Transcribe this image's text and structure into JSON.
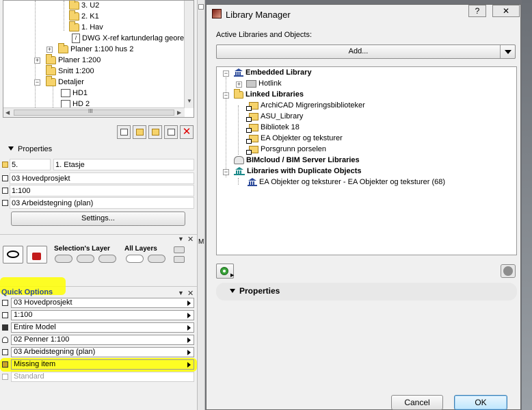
{
  "navigator": {
    "tree": [
      {
        "label": "3. U2",
        "icon": "folder-icon"
      },
      {
        "label": "2. K1",
        "icon": "folder-icon"
      },
      {
        "label": "1. Hav",
        "icon": "folder-icon"
      },
      {
        "label": "DWG X-ref kartunderlag georef",
        "icon": "dwg-icon"
      },
      {
        "label": "Planer 1:100 hus 2",
        "icon": "folder-icon"
      },
      {
        "label": "Planer 1:200",
        "icon": "folder-icon"
      },
      {
        "label": "Snitt 1:200",
        "icon": "folder-icon"
      },
      {
        "label": "Detaljer",
        "icon": "folder-icon"
      },
      {
        "label": "HD1",
        "icon": "detail-icon"
      },
      {
        "label": "HD 2",
        "icon": "detail-icon"
      }
    ],
    "scroll_grip": "III"
  },
  "properties": {
    "header": "Properties",
    "id_value": "5.",
    "name_value": "1. Etasje",
    "layer_combo": "03 Hovedprosjekt",
    "scale": "1:100",
    "view": "03 Arbeidstegning (plan)",
    "settings_label": "Settings..."
  },
  "layers_panel": {
    "selections_label": "Selection's Layer",
    "all_label": "All Layers"
  },
  "quick_options": {
    "title": "Quick Options",
    "rows": [
      {
        "value": "03 Hovedprosjekt",
        "icon": "layers-icon"
      },
      {
        "value": "1:100",
        "icon": "scale-icon"
      },
      {
        "value": "Entire Model",
        "icon": "model-icon"
      },
      {
        "value": "02 Penner 1:100",
        "icon": "pen-icon"
      },
      {
        "value": "03 Arbeidstegning (plan)",
        "icon": "view-icon"
      },
      {
        "value": "Missing item",
        "icon": "missing-icon"
      },
      {
        "value": "Standard",
        "icon": "dimension-icon"
      }
    ],
    "highlight_color": "#ffff00"
  },
  "dialog": {
    "title": "Library Manager",
    "help_label": "?",
    "close_label": "✕",
    "active_label": "Active Libraries and Objects:",
    "add_label": "Add...",
    "tree": {
      "embedded": "Embedded Library",
      "hotlink": "Hotlink",
      "linked": "Linked Libraries",
      "linked_items": [
        "ArchiCAD Migreringsbiblioteker",
        "ASU_Library",
        "Bibliotek 18",
        "EA Objekter og teksturer",
        "Porsgrunn porselen"
      ],
      "bimcloud": "BIMcloud / BIM Server Libraries",
      "duplicates": "Libraries with Duplicate Objects",
      "duplicate_item": "EA Objekter og teksturer - EA Objekter og teksturer (68)"
    },
    "properties_label": "Properties",
    "cancel_label": "Cancel",
    "ok_label": "OK",
    "accent_color": "#3c7fb1"
  },
  "side_strip": {
    "label": "M"
  }
}
